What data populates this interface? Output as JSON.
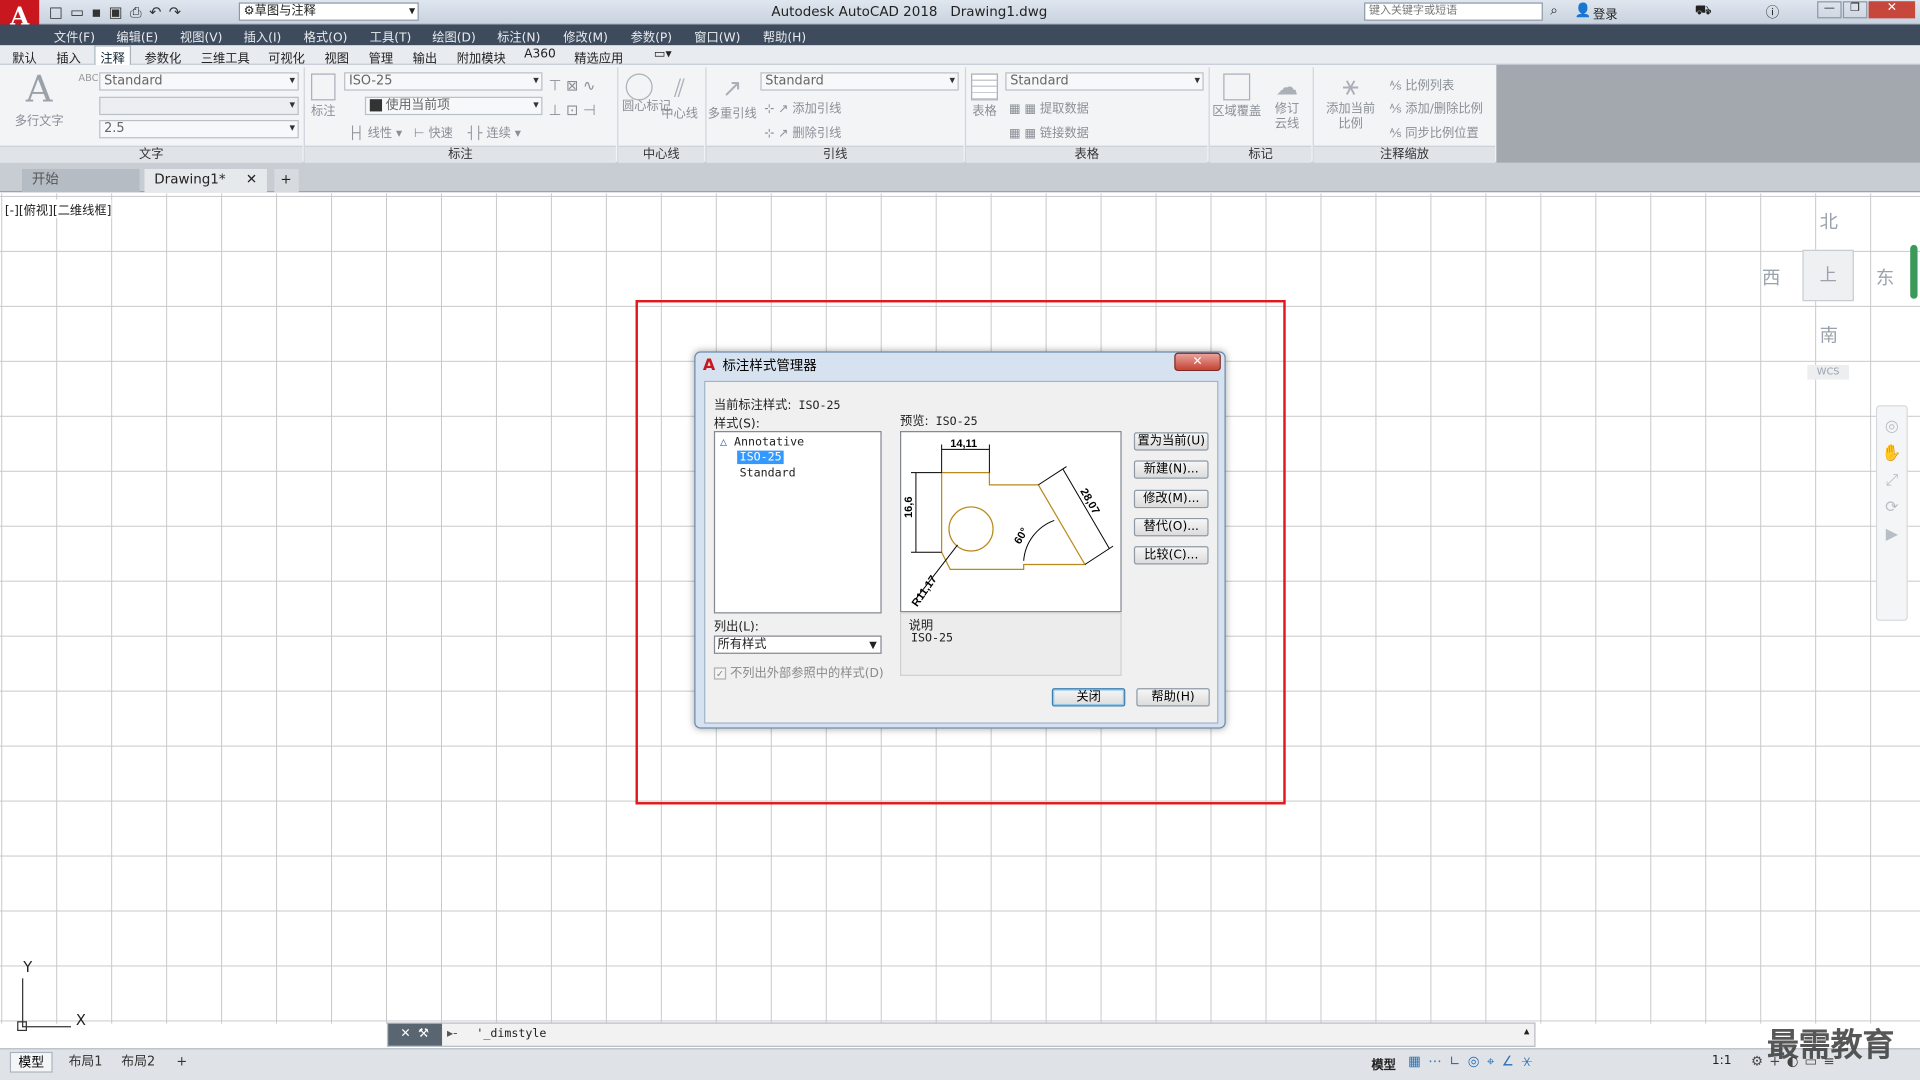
{
  "app": {
    "title": "Autodesk AutoCAD 2018",
    "doc": "Drawing1.dwg",
    "workspace": "草图与注释",
    "search_placeholder": "键入关键字或短语",
    "login": "登录"
  },
  "menu": [
    "文件(F)",
    "编辑(E)",
    "视图(V)",
    "插入(I)",
    "格式(O)",
    "工具(T)",
    "绘图(D)",
    "标注(N)",
    "修改(M)",
    "参数(P)",
    "窗口(W)",
    "帮助(H)"
  ],
  "ribbon_tabs": [
    "默认",
    "插入",
    "注释",
    "参数化",
    "三维工具",
    "可视化",
    "视图",
    "管理",
    "输出",
    "附加模块",
    "A360",
    "精选应用"
  ],
  "ribbon": {
    "text": {
      "big": "多行文字",
      "style": "Standard",
      "height": "2.5",
      "title": "文字"
    },
    "dim": {
      "big": "标注",
      "style": "ISO-25",
      "layer": "使用当前项",
      "b1": "线性",
      "b2": "快速",
      "b3": "连续",
      "title": "标注"
    },
    "center": {
      "b1": "圆心标记",
      "b2": "中心线",
      "title": "中心线"
    },
    "leader": {
      "big": "多重引线",
      "style": "Standard",
      "b1": "添加引线",
      "b2": "删除引线",
      "title": "引线"
    },
    "table": {
      "big": "表格",
      "style": "Standard",
      "b1": "提取数据",
      "b2": "链接数据",
      "title": "表格"
    },
    "mark": {
      "b1": "区域覆盖",
      "b2": "修订云线",
      "title": "标记"
    },
    "scale": {
      "big": "添加当前比例",
      "b1": "比例列表",
      "b2": "添加/删除比例",
      "b3": "同步比例位置",
      "title": "注释缩放"
    }
  },
  "doctabs": {
    "start": "开始",
    "drawing": "Drawing1*",
    "plus": "+"
  },
  "viewport_label": "[-][俯视][二维线框]",
  "viewcube": {
    "n": "北",
    "s": "南",
    "e": "东",
    "w": "西",
    "top": "上",
    "wcs": "WCS"
  },
  "dialog": {
    "title": "标注样式管理器",
    "current_label": "当前标注样式:",
    "current_value": "ISO-25",
    "styles_label": "样式(S):",
    "styles": [
      "Annotative",
      "ISO-25",
      "Standard"
    ],
    "selected_style": "ISO-25",
    "preview_label": "预览:",
    "preview_value": "ISO-25",
    "preview_dims": {
      "d1": "14,11",
      "d2": "16,6",
      "d3": "28,07",
      "d4": "60°",
      "d5": "R11,17"
    },
    "list_label": "列出(L):",
    "list_value": "所有样式",
    "checkbox_label": "不列出外部参照中的样式(D)",
    "desc_label": "说明",
    "desc_value": "ISO-25",
    "buttons": {
      "set_current": "置为当前(U)",
      "new": "新建(N)...",
      "modify": "修改(M)...",
      "override": "替代(O)...",
      "compare": "比较(C)...",
      "close": "关闭",
      "help": "帮助(H)"
    }
  },
  "ucs": {
    "x": "X",
    "y": "Y"
  },
  "command": {
    "text": "'_dimstyle",
    "prompt": "▸-"
  },
  "layout_tabs": [
    "模型",
    "布局1",
    "布局2",
    "+"
  ],
  "status": {
    "model": "模型",
    "scale": "1:1"
  },
  "watermark": "最需教育",
  "colors": {
    "highlight_box": "#e0191e",
    "selection": "#3399ff",
    "preview_geom": "#b98a1a",
    "menubar": "#3d4b5c"
  }
}
